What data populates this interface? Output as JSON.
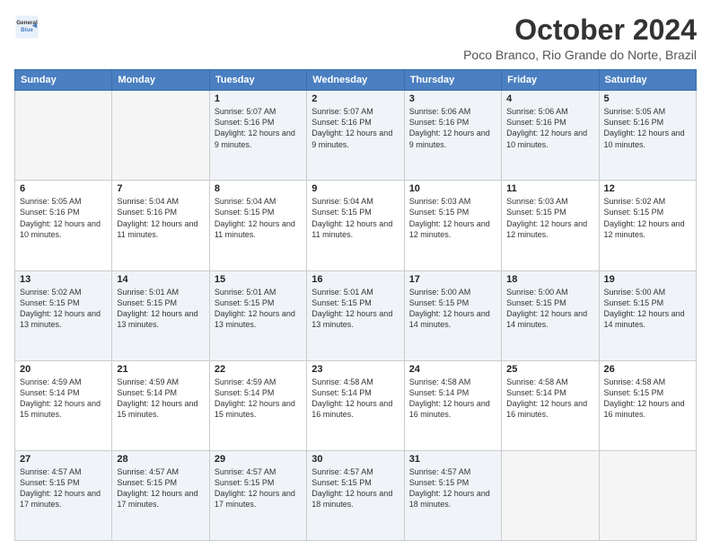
{
  "logo": {
    "line1": "General",
    "line2": "Blue"
  },
  "header": {
    "month": "October 2024",
    "location": "Poco Branco, Rio Grande do Norte, Brazil"
  },
  "weekdays": [
    "Sunday",
    "Monday",
    "Tuesday",
    "Wednesday",
    "Thursday",
    "Friday",
    "Saturday"
  ],
  "weeks": [
    [
      {
        "day": "",
        "info": ""
      },
      {
        "day": "",
        "info": ""
      },
      {
        "day": "1",
        "info": "Sunrise: 5:07 AM\nSunset: 5:16 PM\nDaylight: 12 hours and 9 minutes."
      },
      {
        "day": "2",
        "info": "Sunrise: 5:07 AM\nSunset: 5:16 PM\nDaylight: 12 hours and 9 minutes."
      },
      {
        "day": "3",
        "info": "Sunrise: 5:06 AM\nSunset: 5:16 PM\nDaylight: 12 hours and 9 minutes."
      },
      {
        "day": "4",
        "info": "Sunrise: 5:06 AM\nSunset: 5:16 PM\nDaylight: 12 hours and 10 minutes."
      },
      {
        "day": "5",
        "info": "Sunrise: 5:05 AM\nSunset: 5:16 PM\nDaylight: 12 hours and 10 minutes."
      }
    ],
    [
      {
        "day": "6",
        "info": "Sunrise: 5:05 AM\nSunset: 5:16 PM\nDaylight: 12 hours and 10 minutes."
      },
      {
        "day": "7",
        "info": "Sunrise: 5:04 AM\nSunset: 5:16 PM\nDaylight: 12 hours and 11 minutes."
      },
      {
        "day": "8",
        "info": "Sunrise: 5:04 AM\nSunset: 5:15 PM\nDaylight: 12 hours and 11 minutes."
      },
      {
        "day": "9",
        "info": "Sunrise: 5:04 AM\nSunset: 5:15 PM\nDaylight: 12 hours and 11 minutes."
      },
      {
        "day": "10",
        "info": "Sunrise: 5:03 AM\nSunset: 5:15 PM\nDaylight: 12 hours and 12 minutes."
      },
      {
        "day": "11",
        "info": "Sunrise: 5:03 AM\nSunset: 5:15 PM\nDaylight: 12 hours and 12 minutes."
      },
      {
        "day": "12",
        "info": "Sunrise: 5:02 AM\nSunset: 5:15 PM\nDaylight: 12 hours and 12 minutes."
      }
    ],
    [
      {
        "day": "13",
        "info": "Sunrise: 5:02 AM\nSunset: 5:15 PM\nDaylight: 12 hours and 13 minutes."
      },
      {
        "day": "14",
        "info": "Sunrise: 5:01 AM\nSunset: 5:15 PM\nDaylight: 12 hours and 13 minutes."
      },
      {
        "day": "15",
        "info": "Sunrise: 5:01 AM\nSunset: 5:15 PM\nDaylight: 12 hours and 13 minutes."
      },
      {
        "day": "16",
        "info": "Sunrise: 5:01 AM\nSunset: 5:15 PM\nDaylight: 12 hours and 13 minutes."
      },
      {
        "day": "17",
        "info": "Sunrise: 5:00 AM\nSunset: 5:15 PM\nDaylight: 12 hours and 14 minutes."
      },
      {
        "day": "18",
        "info": "Sunrise: 5:00 AM\nSunset: 5:15 PM\nDaylight: 12 hours and 14 minutes."
      },
      {
        "day": "19",
        "info": "Sunrise: 5:00 AM\nSunset: 5:15 PM\nDaylight: 12 hours and 14 minutes."
      }
    ],
    [
      {
        "day": "20",
        "info": "Sunrise: 4:59 AM\nSunset: 5:14 PM\nDaylight: 12 hours and 15 minutes."
      },
      {
        "day": "21",
        "info": "Sunrise: 4:59 AM\nSunset: 5:14 PM\nDaylight: 12 hours and 15 minutes."
      },
      {
        "day": "22",
        "info": "Sunrise: 4:59 AM\nSunset: 5:14 PM\nDaylight: 12 hours and 15 minutes."
      },
      {
        "day": "23",
        "info": "Sunrise: 4:58 AM\nSunset: 5:14 PM\nDaylight: 12 hours and 16 minutes."
      },
      {
        "day": "24",
        "info": "Sunrise: 4:58 AM\nSunset: 5:14 PM\nDaylight: 12 hours and 16 minutes."
      },
      {
        "day": "25",
        "info": "Sunrise: 4:58 AM\nSunset: 5:14 PM\nDaylight: 12 hours and 16 minutes."
      },
      {
        "day": "26",
        "info": "Sunrise: 4:58 AM\nSunset: 5:15 PM\nDaylight: 12 hours and 16 minutes."
      }
    ],
    [
      {
        "day": "27",
        "info": "Sunrise: 4:57 AM\nSunset: 5:15 PM\nDaylight: 12 hours and 17 minutes."
      },
      {
        "day": "28",
        "info": "Sunrise: 4:57 AM\nSunset: 5:15 PM\nDaylight: 12 hours and 17 minutes."
      },
      {
        "day": "29",
        "info": "Sunrise: 4:57 AM\nSunset: 5:15 PM\nDaylight: 12 hours and 17 minutes."
      },
      {
        "day": "30",
        "info": "Sunrise: 4:57 AM\nSunset: 5:15 PM\nDaylight: 12 hours and 18 minutes."
      },
      {
        "day": "31",
        "info": "Sunrise: 4:57 AM\nSunset: 5:15 PM\nDaylight: 12 hours and 18 minutes."
      },
      {
        "day": "",
        "info": ""
      },
      {
        "day": "",
        "info": ""
      }
    ]
  ]
}
